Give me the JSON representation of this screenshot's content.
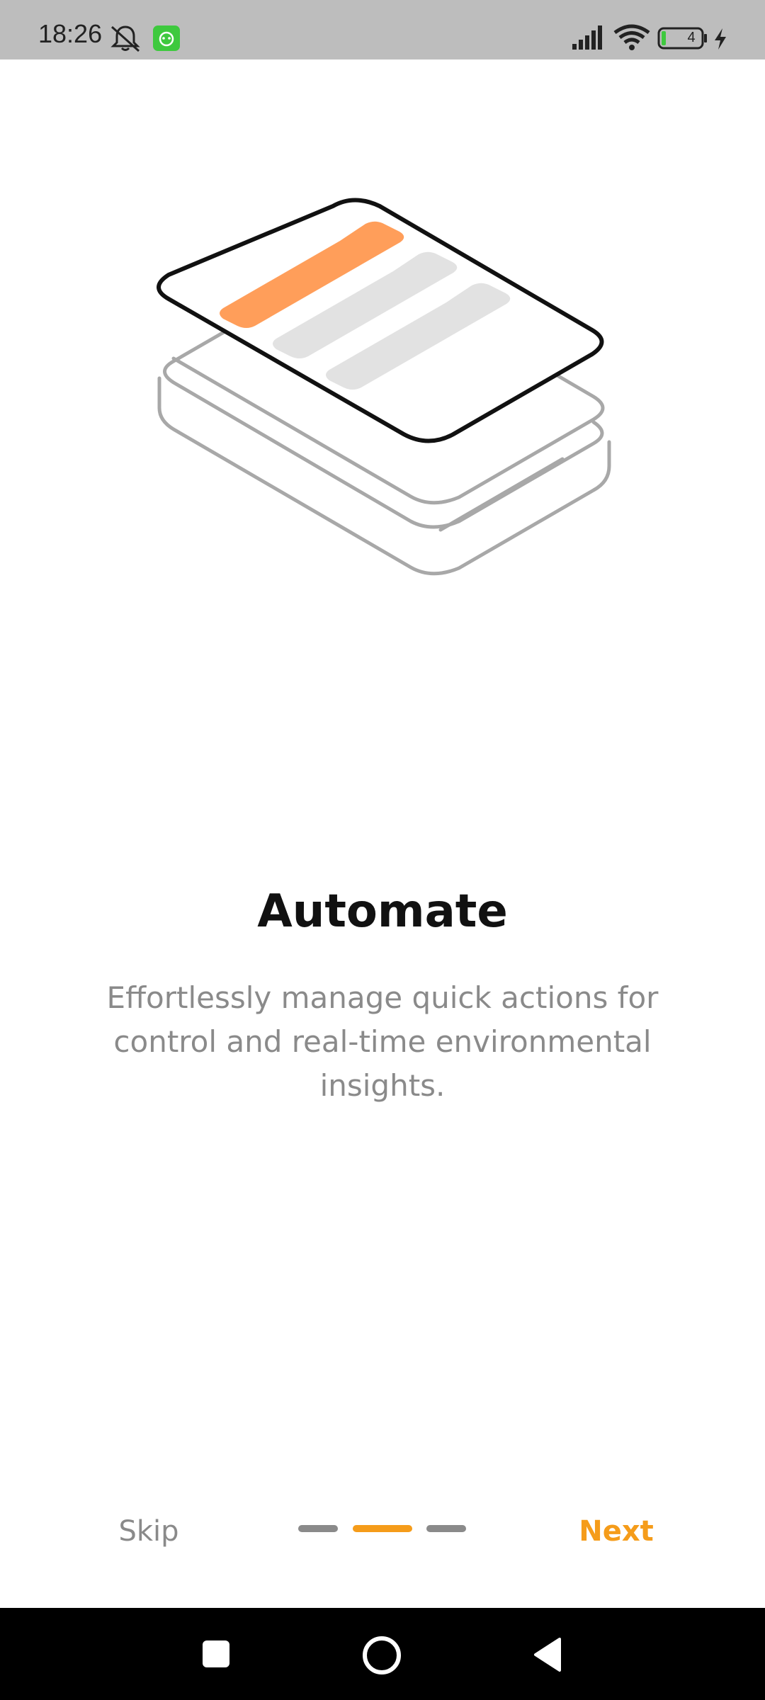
{
  "status_bar": {
    "time": "18:26",
    "battery_level": "4",
    "icons": [
      "mute-icon",
      "app-badge-icon",
      "signal-icon",
      "wifi-icon",
      "battery-icon",
      "charging-icon"
    ]
  },
  "onboarding": {
    "title": "Automate",
    "description": "Effortlessly manage quick actions for control and real-time environmental insights.",
    "skip_label": "Skip",
    "next_label": "Next",
    "current_page": 2,
    "total_pages": 3
  },
  "colors": {
    "accent": "#f59c1a",
    "illustration_accent": "#ff9e5a",
    "muted": "#8a8a8a"
  },
  "nav_bar": {
    "icons": [
      "recents-icon",
      "home-icon",
      "back-icon"
    ]
  }
}
